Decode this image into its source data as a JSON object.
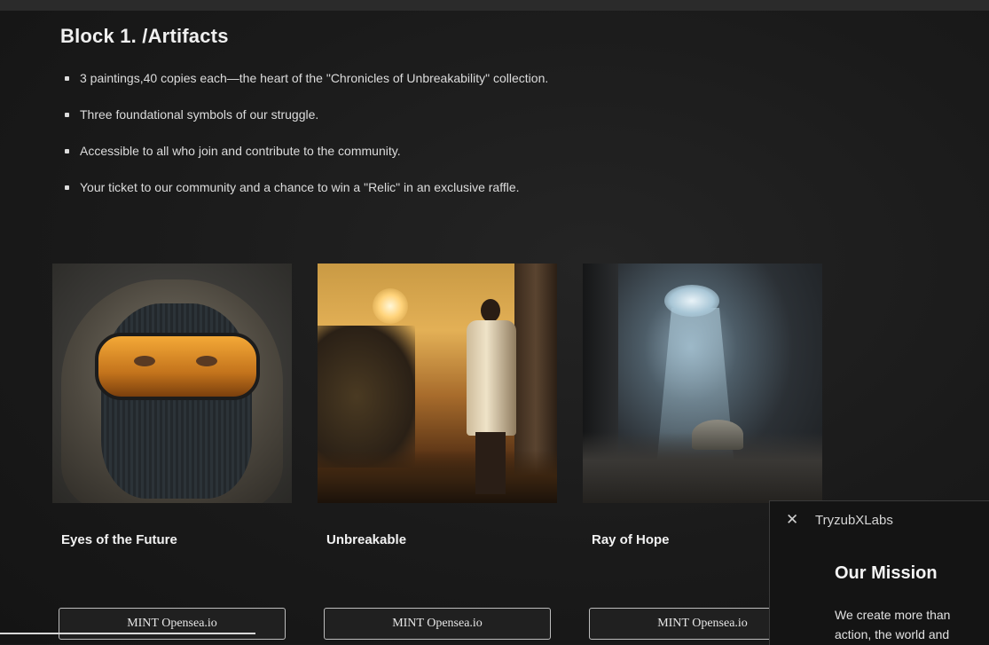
{
  "block": {
    "title": "Block 1. /Artifacts",
    "bullets": [
      "3 paintings,40 copies each—the heart of the \"Chronicles of Unbreakability\" collection.",
      "Three foundational symbols of our struggle.",
      "Accessible to all who join and contribute to the community.",
      "Your ticket to our community and a chance to win a \"Relic\" in an exclusive raffle."
    ]
  },
  "cards": [
    {
      "name": "Eyes of the Future",
      "mint_label": "MINT Opensea.io"
    },
    {
      "name": "Unbreakable",
      "mint_label": "MINT Opensea.io"
    },
    {
      "name": "Ray of Hope",
      "mint_label": "MINT Opensea.io"
    }
  ],
  "panel": {
    "close_glyph": "✕",
    "brand": "TryzubXLabs",
    "heading": "Our Mission",
    "text_lines": [
      "We create more than",
      "action, the world and"
    ]
  }
}
